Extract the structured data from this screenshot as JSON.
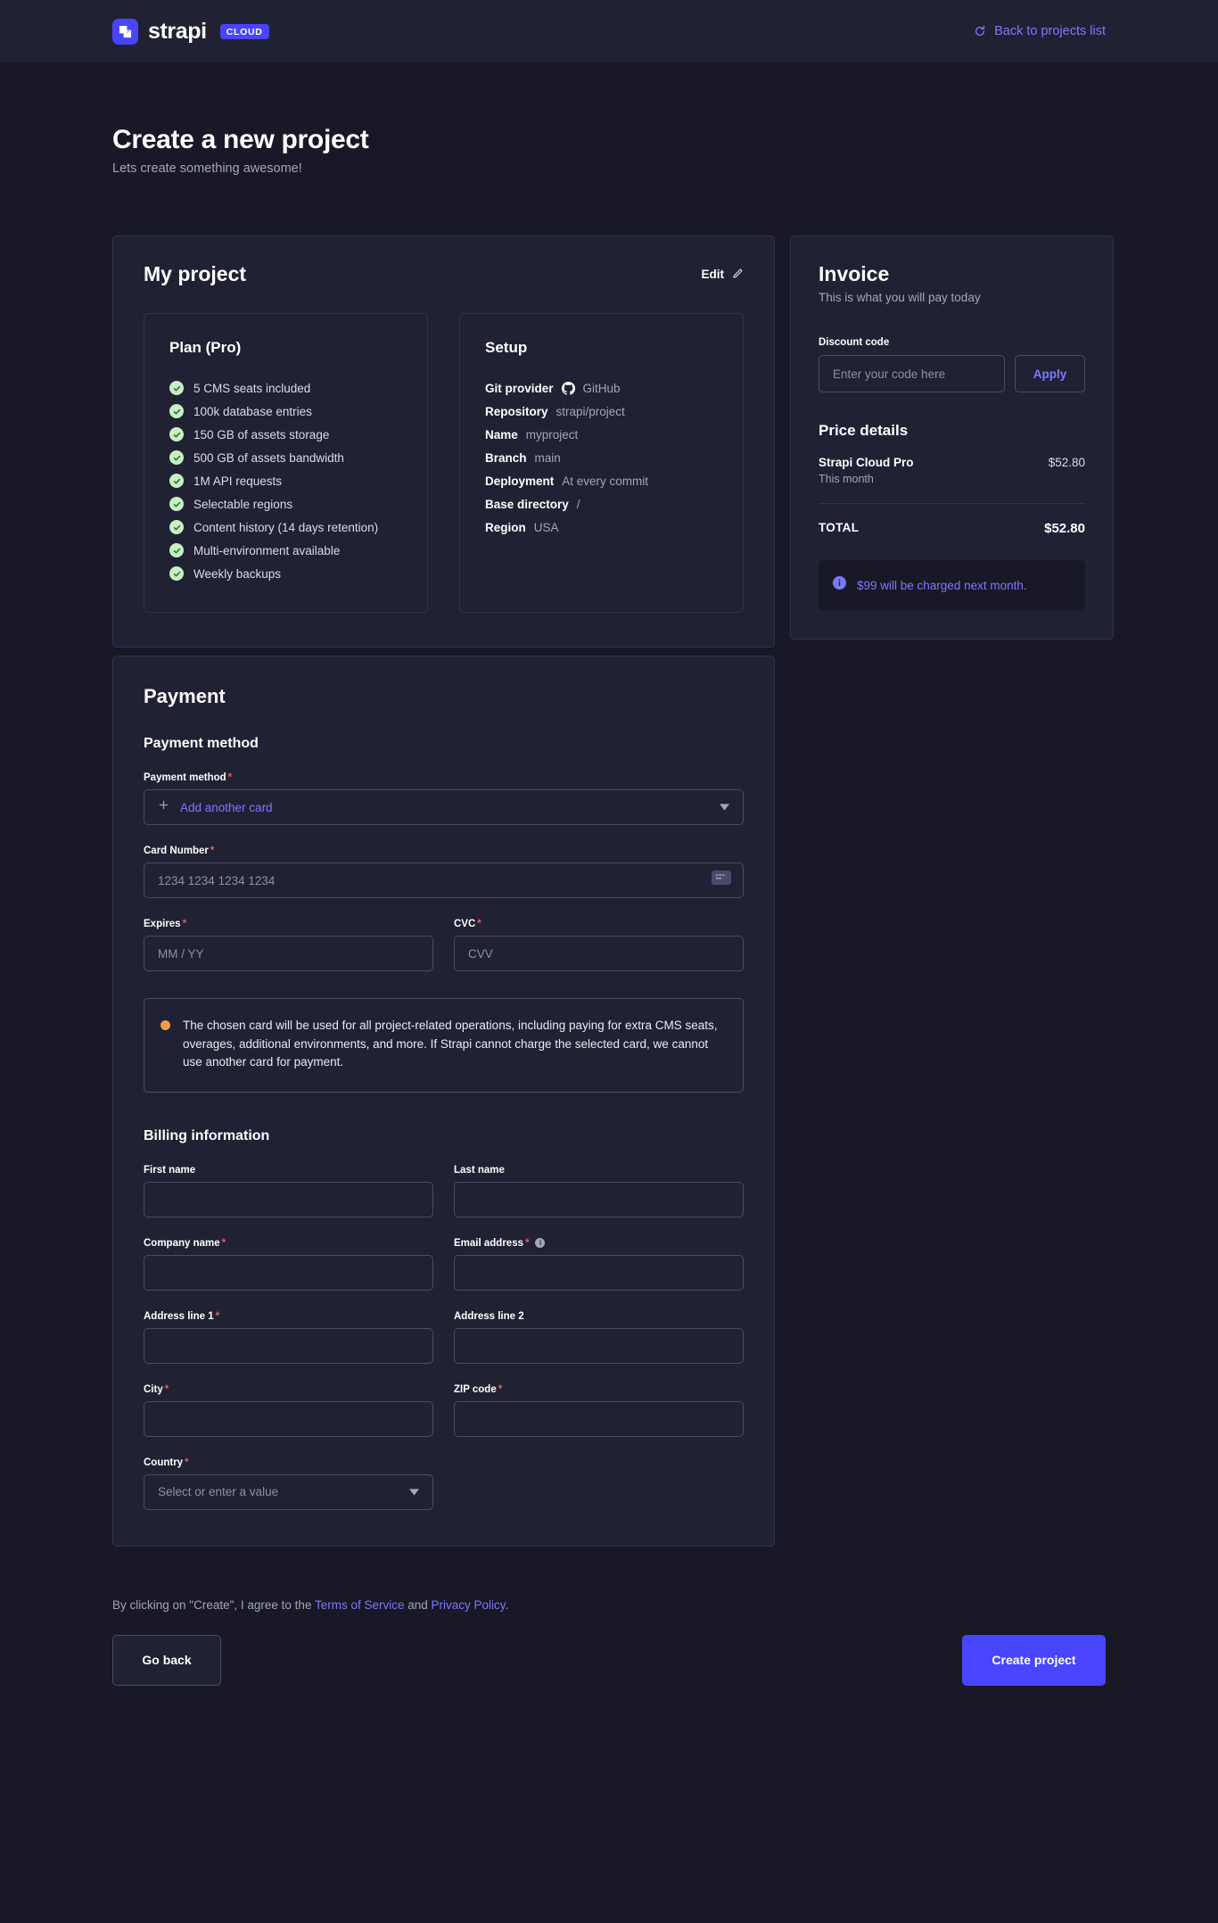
{
  "topbar": {
    "brand_name": "strapi",
    "brand_badge": "CLOUD",
    "back_link": "Back to projects list"
  },
  "header": {
    "title": "Create a new project",
    "subtitle": "Lets create something awesome!"
  },
  "project": {
    "name": "My project",
    "edit_label": "Edit",
    "plan": {
      "title": "Plan (Pro)",
      "features": [
        "5 CMS seats included",
        "100k database entries",
        "150 GB of assets storage",
        "500 GB of assets bandwidth",
        "1M API requests",
        "Selectable regions",
        "Content history (14 days retention)",
        "Multi-environment available",
        "Weekly backups"
      ]
    },
    "setup": {
      "title": "Setup",
      "rows": [
        {
          "key": "Git provider",
          "value": "GitHub",
          "icon": "github-icon"
        },
        {
          "key": "Repository",
          "value": "strapi/project"
        },
        {
          "key": "Name",
          "value": "myproject"
        },
        {
          "key": "Branch",
          "value": "main"
        },
        {
          "key": "Deployment",
          "value": "At every commit"
        },
        {
          "key": "Base directory",
          "value": "/"
        },
        {
          "key": "Region",
          "value": "USA"
        }
      ]
    }
  },
  "invoice": {
    "title": "Invoice",
    "subtitle": "This is what you will pay today",
    "discount_label": "Discount code",
    "discount_placeholder": "Enter your code here",
    "discount_value": "",
    "apply_label": "Apply",
    "price_title": "Price details",
    "line_item_name": "Strapi Cloud Pro",
    "line_item_note": "This month",
    "line_item_amount": "$52.80",
    "total_label": "TOTAL",
    "total_amount": "$52.80",
    "notice": "$99 will be charged next month."
  },
  "payment": {
    "section_title": "Payment",
    "method_heading": "Payment method",
    "method_label": "Payment method",
    "method_value": "Add another card",
    "card_number_label": "Card Number",
    "card_number_placeholder": "1234 1234 1234 1234",
    "card_number_value": "",
    "expires_label": "Expires",
    "expires_placeholder": "MM / YY",
    "expires_value": "",
    "cvc_label": "CVC",
    "cvc_placeholder": "CVV",
    "cvc_value": "",
    "warning": "The chosen card will be used for all project-related operations, including paying for extra CMS seats, overages, additional environments, and more. If Strapi cannot charge the selected card, we cannot use another card for payment."
  },
  "billing": {
    "heading": "Billing information",
    "first_name_label": "First name",
    "first_name_value": "",
    "last_name_label": "Last name",
    "last_name_value": "",
    "company_label": "Company name",
    "company_value": "",
    "email_label": "Email address",
    "email_value": "",
    "address1_label": "Address line 1",
    "address1_value": "",
    "address2_label": "Address line 2",
    "address2_value": "",
    "city_label": "City",
    "city_value": "",
    "zip_label": "ZIP code",
    "zip_value": "",
    "country_label": "Country",
    "country_placeholder": "Select or enter a value"
  },
  "footer": {
    "terms_prefix": "By clicking on \"Create\", I agree to the ",
    "terms_link": "Terms of Service",
    "terms_mid": " and ",
    "privacy_link": "Privacy Policy",
    "terms_suffix": ".",
    "go_back_label": "Go back",
    "create_label": "Create project"
  },
  "colors": {
    "background": "#181826",
    "surface": "#212134",
    "border": "#32324d",
    "accent": "#4945ff",
    "accent_text": "#7b79ff",
    "required": "#ee5e52",
    "success": "#c6f0c2",
    "warning": "#f29d41"
  }
}
